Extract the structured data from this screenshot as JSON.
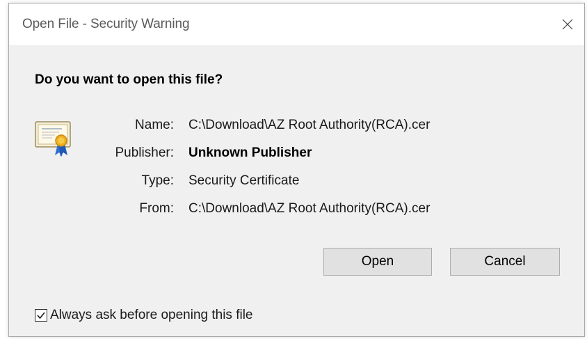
{
  "window": {
    "title": "Open File - Security Warning",
    "close_glyph": "close-icon"
  },
  "question": "Do you want to open this file?",
  "icon": "certificate-icon",
  "fields": [
    {
      "label": "Name:",
      "value": "C:\\Download\\AZ Root Authority(RCA).cer",
      "bold": false
    },
    {
      "label": "Publisher:",
      "value": "Unknown Publisher",
      "bold": true
    },
    {
      "label": "Type:",
      "value": "Security Certificate",
      "bold": false
    },
    {
      "label": "From:",
      "value": "C:\\Download\\AZ Root Authority(RCA).cer",
      "bold": false
    }
  ],
  "buttons": {
    "open_label": "Open",
    "cancel_label": "Cancel"
  },
  "footer": {
    "checkbox_label": "Always ask before opening this file",
    "checked": true
  },
  "colors": {
    "dialog_bg": "#f0f0f0",
    "titlebar_bg": "#ffffff",
    "button_bg": "#e1e1e1",
    "button_border": "#adadad"
  }
}
